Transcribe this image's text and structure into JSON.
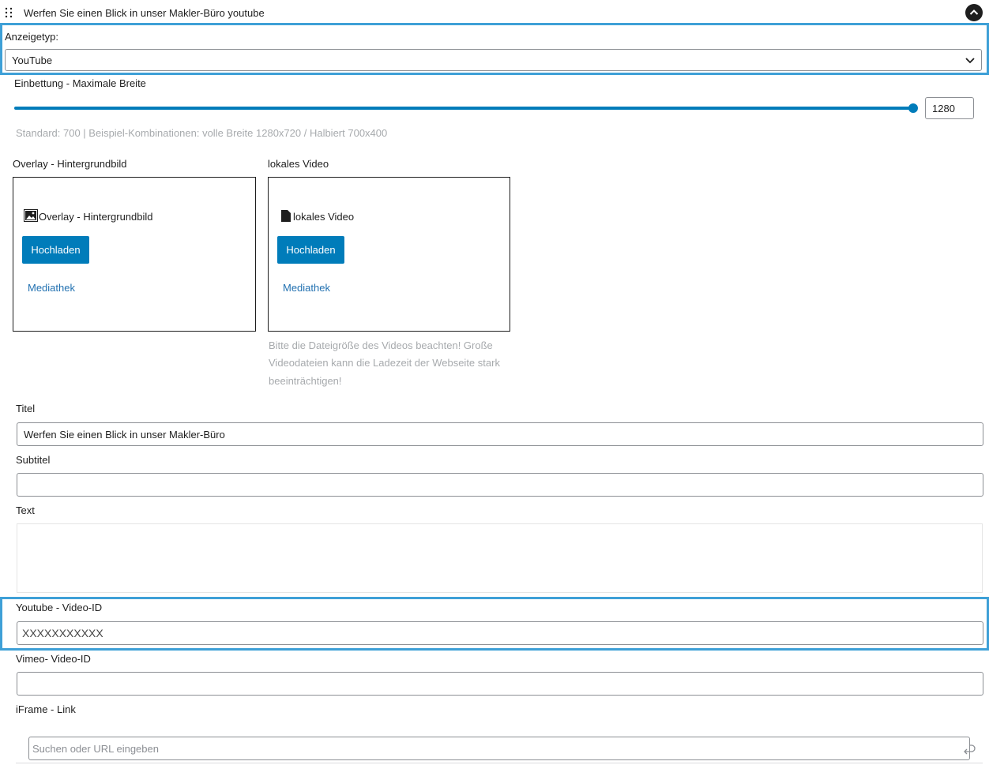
{
  "block": {
    "title": "Werfen Sie einen Blick in unser Makler-Büro youtube",
    "drag_icon": "drag-handle-icon",
    "collapse_icon": "chevron-up-circle-icon"
  },
  "display_type": {
    "label": "Anzeigetyp:",
    "value": "YouTube"
  },
  "embed_width": {
    "label": "Einbettung - Maximale Breite",
    "value": "1280",
    "slider_fraction": 1.0,
    "help": "Standard: 700 | Beispiel-Kombinationen: volle Breite 1280x720 / Halbiert 700x400"
  },
  "overlay": {
    "label": "Overlay - Hintergrundbild",
    "box_title": "Overlay - Hintergrundbild",
    "upload": "Hochladen",
    "library": "Mediathek"
  },
  "local_video": {
    "label": "lokales Video",
    "box_title": "lokales Video",
    "upload": "Hochladen",
    "library": "Mediathek",
    "help_line1": "Bitte die Dateigröße des Videos beachten! Große",
    "help_line2": "Videodateien kann die Ladezeit der Webseite stark",
    "help_line3": "beeinträchtigen!"
  },
  "fields": {
    "title_label": "Titel",
    "title_value": "Werfen Sie einen Blick in unser Makler-Büro",
    "subtitle_label": "Subtitel",
    "subtitle_value": "",
    "text_label": "Text",
    "text_value": "",
    "youtube_label": "Youtube - Video-ID",
    "youtube_value": "XXXXXXXXXXX",
    "vimeo_label": "Vimeo- Video-ID",
    "vimeo_value": "",
    "iframe_label": "iFrame - Link",
    "iframe_placeholder": "Suchen oder URL eingeben"
  },
  "colors": {
    "accent": "#007cba",
    "highlight": "#3ea0d7",
    "link": "#2271b1"
  }
}
